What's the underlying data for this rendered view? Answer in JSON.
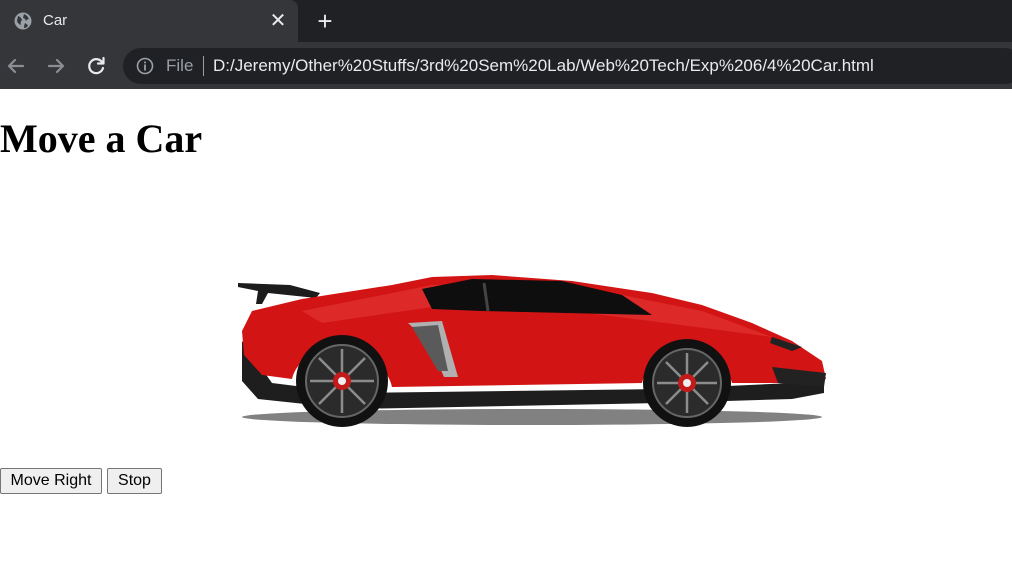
{
  "browser": {
    "tab": {
      "title": "Car",
      "close_glyph": "✕",
      "favicon": "globe-icon"
    },
    "new_tab_glyph": "+",
    "nav": {
      "back": "back-arrow-icon",
      "forward": "forward-arrow-icon",
      "reload": "reload-icon"
    },
    "address_bar": {
      "scheme_label": "File",
      "url": "D:/Jeremy/Other%20Stuffs/3rd%20Sem%20Lab/Web%20Tech/Exp%206/4%20Car.html",
      "icon": "info-icon"
    },
    "colors": {
      "chrome_dark": "#202124",
      "chrome_tab": "#35363a",
      "text": "#e8eaed",
      "muted": "#9aa0a6"
    }
  },
  "page": {
    "title": "Move a Car",
    "image": {
      "subject": "red sports car",
      "icon": "car-image"
    },
    "buttons": {
      "move_right": "Move Right",
      "stop": "Stop"
    },
    "colors": {
      "car_body": "#d31414",
      "background": "#ffffff"
    }
  }
}
